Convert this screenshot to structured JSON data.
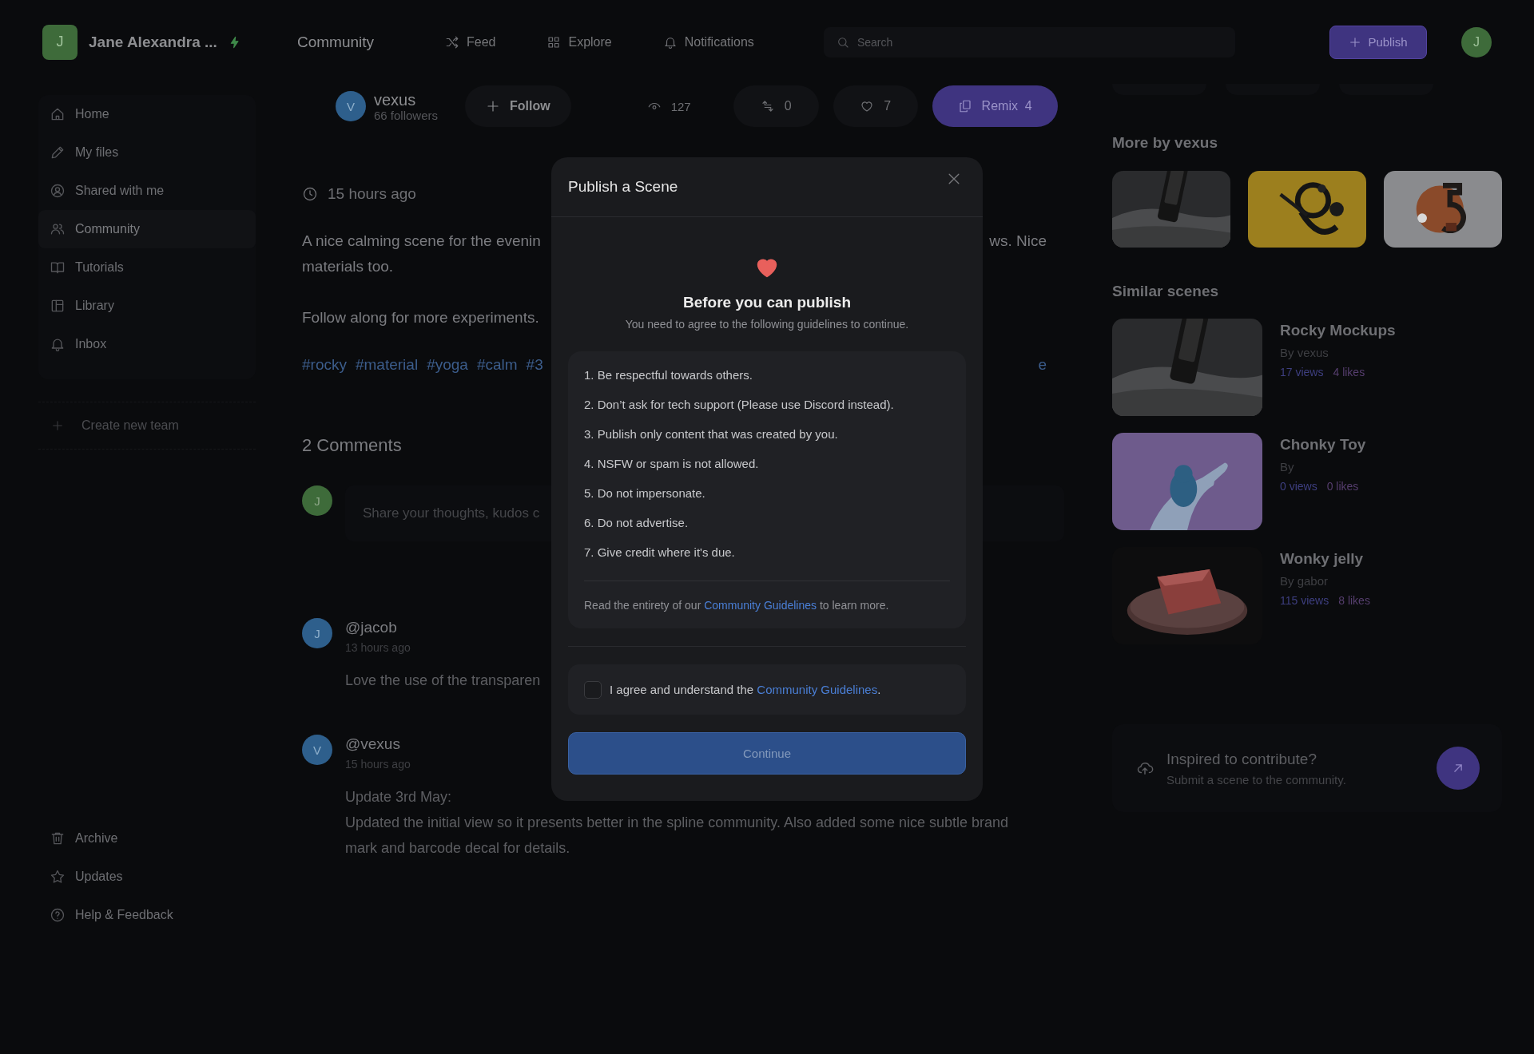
{
  "topbar": {
    "user": {
      "initial": "J",
      "name": "Jane Alexandra ...",
      "color": "#3e6b3a"
    },
    "section": "Community",
    "nav": [
      {
        "label": "Feed",
        "selected": false
      },
      {
        "label": "Explore",
        "selected": false
      },
      {
        "label": "Notifications",
        "selected": false
      }
    ],
    "search": {
      "placeholder": "Search"
    },
    "publish": "Publish",
    "avatar": {
      "initial": "J",
      "color": "#3e6b3a"
    }
  },
  "sidebar": {
    "items": [
      {
        "label": "Home",
        "selected": false
      },
      {
        "label": "My files",
        "selected": false
      },
      {
        "label": "Shared with me",
        "selected": false
      },
      {
        "label": "Community",
        "selected": true
      },
      {
        "label": "Tutorials",
        "selected": false
      },
      {
        "label": "Library",
        "selected": false
      },
      {
        "label": "Inbox",
        "selected": false
      }
    ],
    "create_team": "Create new team",
    "footer_items": [
      {
        "label": "Archive"
      },
      {
        "label": "Updates"
      },
      {
        "label": "Help & Feedback"
      }
    ]
  },
  "scene": {
    "author": {
      "initial": "V",
      "name": "vexus",
      "followers": "66 followers",
      "color": "#2e5f8c"
    },
    "follow": "Follow",
    "views": "127",
    "remixes": "0",
    "likes": "7",
    "remix": {
      "label": "Remix",
      "count": "4"
    },
    "posted": "15 hours ago",
    "description_lines": [
      {
        "left": "A nice calming scene for the evenin",
        "right": "ws. Nice"
      },
      {
        "left": "materials too."
      }
    ],
    "follow_along": "Follow along for more experiments.",
    "tags": [
      "#rocky",
      "#material",
      "#yoga",
      "#calm",
      "#3"
    ],
    "tags_right": "e"
  },
  "comments": {
    "title": "2 Comments",
    "composer": {
      "initial": "J",
      "color": "#3e6b3a",
      "placeholder": "Share your thoughts, kudos c"
    },
    "items": [
      {
        "initial": "J",
        "color": "#2e5f8c",
        "handle": "@jacob",
        "time": "13 hours ago",
        "lines": [
          "Love the use of the transparen"
        ]
      },
      {
        "initial": "V",
        "color": "#2e5f8c",
        "handle": "@vexus",
        "time": "15 hours ago",
        "lines": [
          "Update 3rd May:",
          "Updated the initial view so it presents better in the spline community. Also added some nice subtle brand",
          "mark and barcode decal for details."
        ]
      }
    ]
  },
  "more_by": {
    "title": "More by vexus"
  },
  "similar": {
    "title": "Similar scenes",
    "items": [
      {
        "kind": "picture",
        "title": "Rocky Mockups",
        "author": "By vexus",
        "views": "17 views",
        "likes": "4 likes"
      },
      {
        "kind": "picture",
        "title": "Chonky Toy",
        "author": "By",
        "views": "0 views",
        "likes": "0 likes"
      },
      {
        "kind": "picture",
        "title": "Wonky jelly",
        "author": "By gabor",
        "views": "115 views",
        "likes": "8 likes"
      }
    ]
  },
  "contribute": {
    "title": "Inspired to contribute?",
    "subtitle": "Submit a scene to the community."
  },
  "modal": {
    "title": "Publish a Scene",
    "heading": "Before you can publish",
    "subtitle": "You need to agree to the following guidelines to continue.",
    "guidelines": [
      "1. Be respectful towards others.",
      "2. Don’t ask for tech support (Please use Discord instead).",
      "3. Publish only content that was created by you.",
      "4. NSFW or spam is not allowed.",
      "5. Do not impersonate.",
      "6. Do not advertise.",
      "7. Give credit where it's due."
    ],
    "footnote": {
      "before": "Read the entirety of our ",
      "link": "Community Guidelines",
      "after": " to learn more."
    },
    "agree": {
      "checked": false,
      "before": "I agree and understand the ",
      "link": "Community Guidelines",
      "after": "."
    },
    "continue": {
      "label": "Continue",
      "disabled": true
    }
  }
}
